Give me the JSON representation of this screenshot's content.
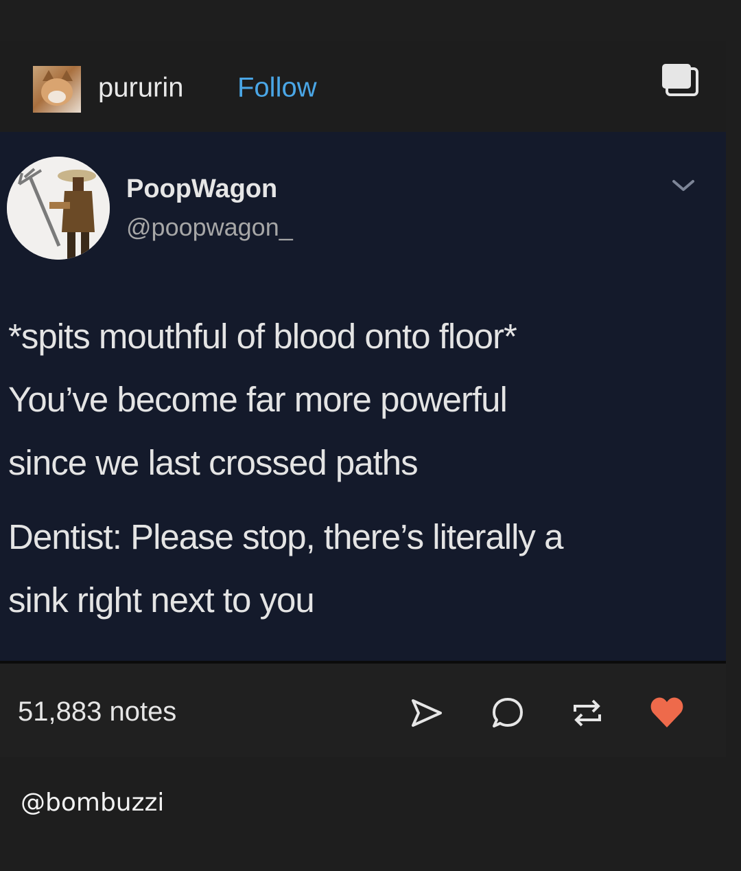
{
  "post": {
    "author": "pururin",
    "follow_label": "Follow",
    "notes": "51,883 notes"
  },
  "tweet": {
    "display_name": "PoopWagon",
    "handle": "@poopwagon_",
    "lines": [
      "*spits mouthful of blood onto floor*",
      "You’ve become far more powerful",
      "since we last crossed paths",
      "Dentist: Please stop, there’s literally a",
      "sink right next to you"
    ]
  },
  "icons": {
    "header": "copy-icon",
    "tweet_menu": "chevron-down-icon",
    "actions": [
      "share-icon",
      "reply-icon",
      "reblog-icon",
      "heart-icon"
    ]
  },
  "colors": {
    "follow": "#4aa6e6",
    "heart": "#ee6a4b",
    "tweet_background": "#141a2b"
  },
  "watermark": "@bombuzzi"
}
